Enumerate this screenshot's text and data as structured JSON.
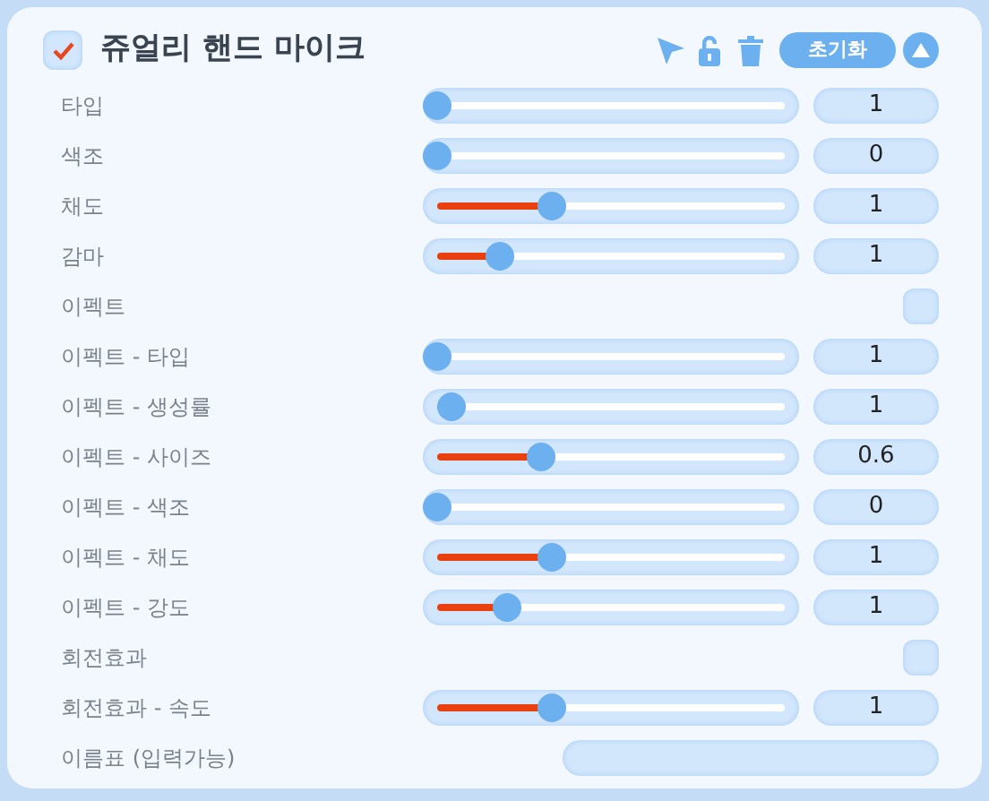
{
  "header": {
    "checked": true,
    "title": "쥬얼리 핸드 마이크",
    "reset_label": "초기화",
    "expanded": true
  },
  "rows": [
    {
      "kind": "slider",
      "label": "타입",
      "level": 0,
      "value": "1"
    },
    {
      "kind": "slider",
      "label": "색조",
      "level": 0,
      "value": "0"
    },
    {
      "kind": "slider",
      "label": "채도",
      "level": 0.33,
      "value": "1"
    },
    {
      "kind": "slider",
      "label": "감마",
      "level": 0.18,
      "value": "1"
    },
    {
      "kind": "checkbox",
      "label": "이펙트",
      "checked": false
    },
    {
      "kind": "slider",
      "label": "이펙트 - 타입",
      "level": 0,
      "value": "1"
    },
    {
      "kind": "slider",
      "label": "이펙트 - 생성률",
      "level": 0.04,
      "value": "1"
    },
    {
      "kind": "slider",
      "label": "이펙트 - 사이즈",
      "level": 0.3,
      "value": "0.6"
    },
    {
      "kind": "slider",
      "label": "이펙트 - 색조",
      "level": 0,
      "value": "0"
    },
    {
      "kind": "slider",
      "label": "이펙트 - 채도",
      "level": 0.33,
      "value": "1"
    },
    {
      "kind": "slider",
      "label": "이펙트 - 강도",
      "level": 0.2,
      "value": "1"
    },
    {
      "kind": "checkbox",
      "label": "회전효과",
      "checked": false
    },
    {
      "kind": "slider",
      "label": "회전효과 - 속도",
      "level": 0.33,
      "value": "1"
    },
    {
      "kind": "text",
      "label": "이름표 (입력가능)"
    }
  ]
}
